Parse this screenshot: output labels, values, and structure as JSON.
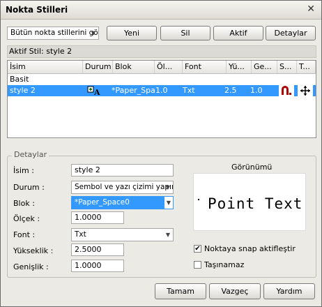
{
  "window": {
    "title": "Nokta Stilleri",
    "close": "✕"
  },
  "toolbar": {
    "filter_value": "Bütün nokta stillerini gö",
    "new_label": "Yeni",
    "delete_label": "Sil",
    "active_label": "Aktif",
    "details_label": "Detaylar"
  },
  "active_style": {
    "text": "Aktif Stil:  style 2"
  },
  "grid": {
    "columns": [
      "İsim",
      "Durum",
      "Blok",
      "Öl...",
      "Font",
      "Yü...",
      "Ge...",
      "S...",
      "T..."
    ],
    "rows": [
      {
        "name": "Basit",
        "status": "",
        "block": "",
        "scale": "",
        "font": "",
        "height": "",
        "width": "",
        "snap": "",
        "move": ""
      },
      {
        "name": "style 2",
        "status": "symbol+text",
        "block": "*Paper_Spac",
        "scale": "1.0",
        "font": "Txt",
        "height": "2.5",
        "width": "1.0",
        "snap": "snap-icon",
        "move": "move-icon"
      }
    ]
  },
  "details": {
    "group_title": "Detaylar",
    "name_label": "İsim :",
    "name_value": "style 2",
    "status_label": "Durum :",
    "status_value": "Sembol ve yazı çizimi yapır",
    "block_label": "Blok :",
    "block_value": "*Paper_Space0",
    "scale_label": "Ölçek :",
    "scale_value": "1.0000",
    "font_label": "Font :",
    "font_value": "Txt",
    "height_label": "Yükseklik :",
    "height_value": "2.5000",
    "width_label": "Genişlik :",
    "width_value": "1.0000",
    "preview_title": "Görünümü",
    "preview_text": "Point Text",
    "snap_label": "Noktaya snap aktifleştir",
    "snap_checked": true,
    "immovable_label": "Taşınamaz",
    "immovable_checked": false
  },
  "footer": {
    "ok_label": "Tamam",
    "cancel_label": "Vazgeç",
    "help_label": "Yardım"
  },
  "colors": {
    "selection": "#3399ff",
    "dialog_bg": "#eceae4"
  }
}
